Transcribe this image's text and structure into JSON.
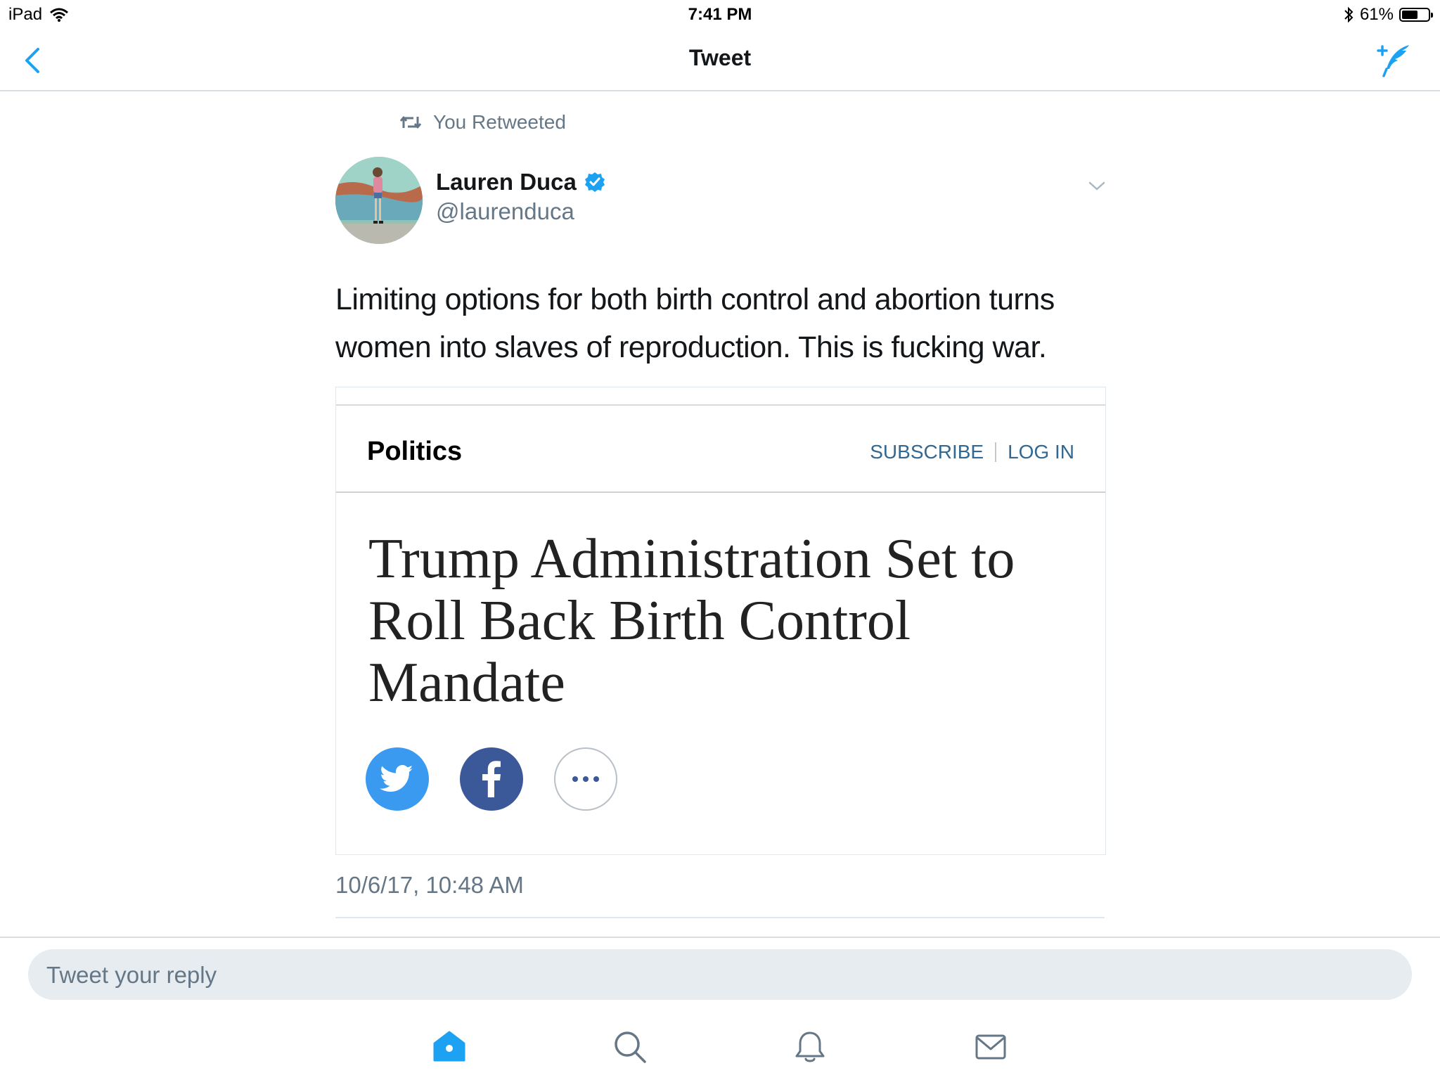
{
  "status_bar": {
    "device": "iPad",
    "time": "7:41 PM",
    "battery_percent": "61%",
    "battery_level": 0.61,
    "wifi_icon": "wifi-icon",
    "bluetooth_icon": "bluetooth-icon"
  },
  "nav": {
    "title": "Tweet",
    "back_icon": "chevron-left-icon",
    "compose_icon": "compose-tweet-icon"
  },
  "tweet": {
    "retweet_label": "You Retweeted",
    "user_name": "Lauren Duca",
    "user_handle": "@laurenduca",
    "verified": true,
    "text": "Limiting options for both birth control and abortion turns women into slaves of reproduction. This is fucking war.",
    "timestamp": "10/6/17, 10:48 AM"
  },
  "card": {
    "section": "Politics",
    "subscribe_label": "SUBSCRIBE",
    "login_label": "LOG IN",
    "headline": "Trump Administration Set to Roll Back Birth Control Mandate",
    "share_icons": [
      "twitter-icon",
      "facebook-icon",
      "more-icon"
    ]
  },
  "reply": {
    "placeholder": "Tweet your reply"
  },
  "tabs": [
    {
      "name": "home",
      "icon": "home-icon",
      "active": true
    },
    {
      "name": "search",
      "icon": "search-icon",
      "active": false
    },
    {
      "name": "notifications",
      "icon": "bell-icon",
      "active": false
    },
    {
      "name": "messages",
      "icon": "mail-icon",
      "active": false
    }
  ],
  "colors": {
    "accent": "#1da1f2",
    "secondary_text": "#657786",
    "link_blue": "#326891",
    "twitter_share": "#3a9af0",
    "facebook_share": "#3b5998"
  }
}
